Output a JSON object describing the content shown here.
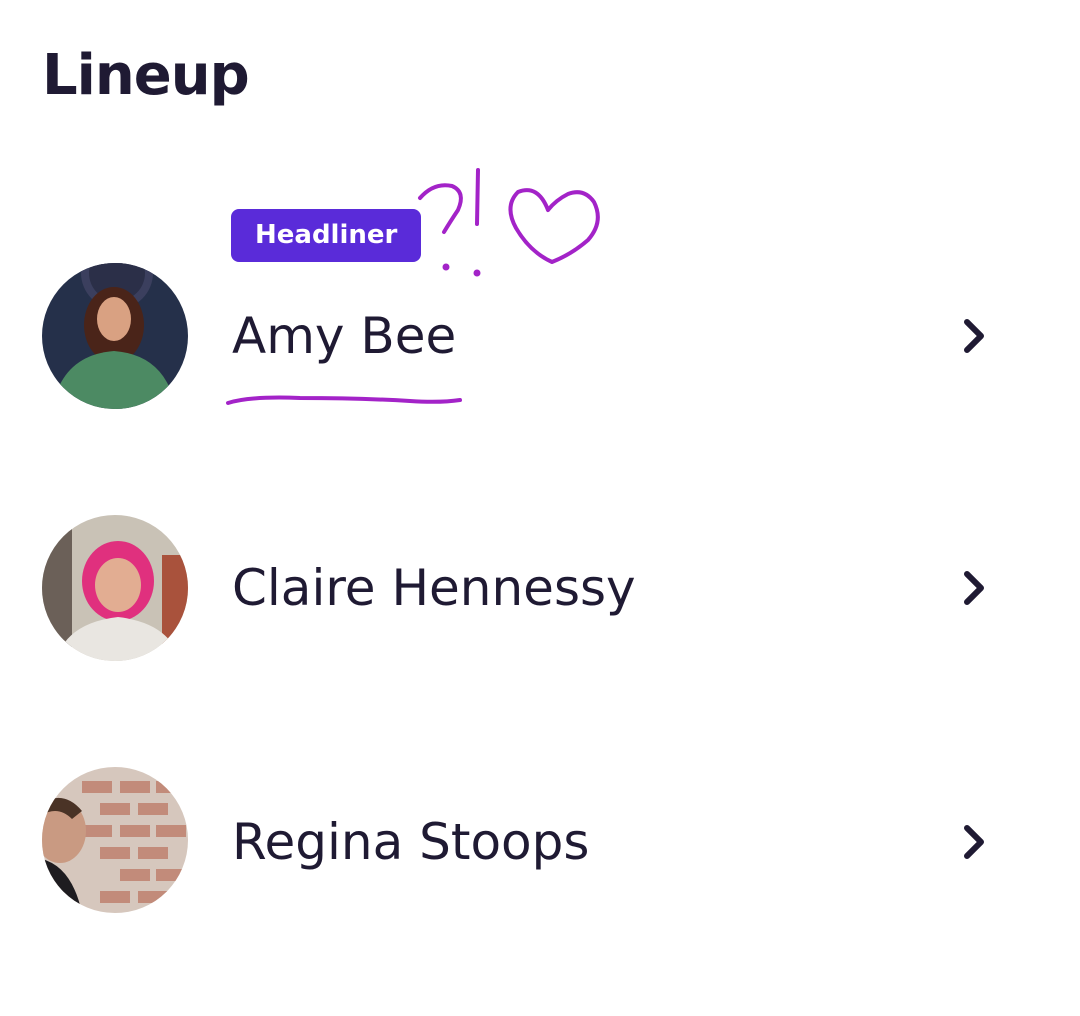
{
  "page": {
    "title": "Lineup"
  },
  "lineup": [
    {
      "name": "Amy Bee",
      "badge": "Headliner",
      "avatar_icon": "avatar-photo",
      "chevron_icon": "chevron-right-icon"
    },
    {
      "name": "Claire Hennessy",
      "avatar_icon": "avatar-photo",
      "chevron_icon": "chevron-right-icon"
    },
    {
      "name": "Regina Stoops",
      "avatar_icon": "avatar-photo",
      "chevron_icon": "chevron-right-icon"
    }
  ],
  "annotations": {
    "color": "#a323c8",
    "items": [
      "question-exclamation-mark",
      "heart-doodle",
      "underline-mark"
    ]
  },
  "colors": {
    "text": "#1f1a33",
    "badge_bg": "#5a2bd9",
    "badge_text": "#ffffff",
    "background": "#ffffff"
  }
}
